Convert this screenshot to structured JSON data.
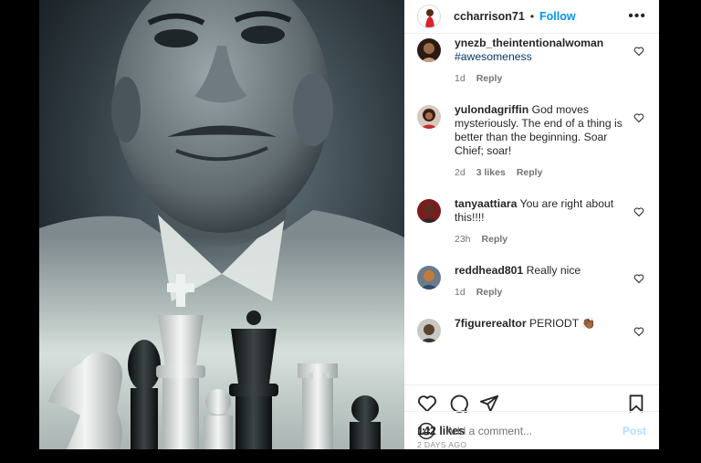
{
  "post": {
    "author": "ccharrison71",
    "separator": "•",
    "follow_label": "Follow",
    "more_label": "•••",
    "likes": "142 likes",
    "date": "2 DAYS AGO",
    "comment_placeholder": "Add a comment...",
    "post_label": "Post"
  },
  "comments": [
    {
      "user": "ynezb_theintentionalwoman",
      "text": "",
      "tag": "#awesomeness",
      "age": "1d",
      "likes": "",
      "reply": "Reply"
    },
    {
      "user": "yulondagriffin",
      "text": "God moves mysteriously. The end of a thing is better than the beginning. Soar Chief; soar!",
      "tag": "",
      "age": "2d",
      "likes": "3 likes",
      "reply": "Reply"
    },
    {
      "user": "tanyaattiara",
      "text": "You are right about this!!!!",
      "tag": "",
      "age": "23h",
      "likes": "",
      "reply": "Reply"
    },
    {
      "user": "reddhead801",
      "text": "Really nice",
      "tag": "",
      "age": "1d",
      "likes": "",
      "reply": "Reply"
    },
    {
      "user": "7figurerealtor",
      "text": "PERIODT 👏🏾",
      "tag": "",
      "age": "",
      "likes": "",
      "reply": ""
    }
  ],
  "icons": {
    "like": "heart-icon",
    "comment": "comment-bubble-icon",
    "share": "paper-plane-icon",
    "save": "bookmark-icon",
    "emoji": "smiley-icon",
    "more": "ellipsis-icon"
  },
  "colors": {
    "link": "#0095f6",
    "hashtag": "#00376b",
    "muted": "#737373",
    "post_disabled": "#b2dffc"
  }
}
